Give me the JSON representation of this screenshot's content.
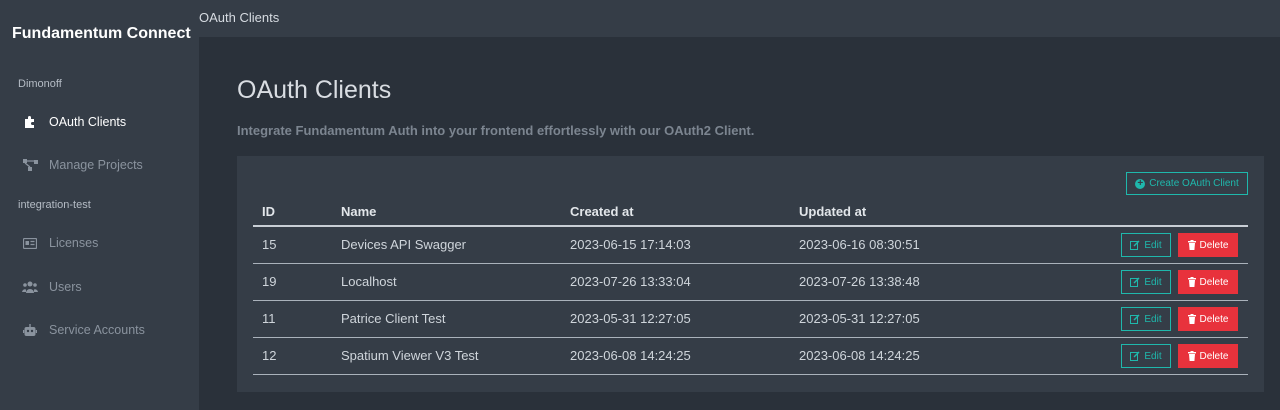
{
  "app": {
    "brand": "Fundamentum Connect"
  },
  "sidebar": {
    "groups": [
      {
        "label": "Dimonoff"
      },
      {
        "label": "integration-test"
      }
    ],
    "items": [
      {
        "label": "OAuth Clients",
        "icon": "puzzle-icon",
        "active": true
      },
      {
        "label": "Manage Projects",
        "icon": "project-diagram-icon",
        "active": false
      },
      {
        "label": "Licenses",
        "icon": "license-card-icon",
        "active": false
      },
      {
        "label": "Users",
        "icon": "users-icon",
        "active": false
      },
      {
        "label": "Service Accounts",
        "icon": "robot-icon",
        "active": false
      }
    ]
  },
  "topbar": {
    "title": "OAuth Clients"
  },
  "page": {
    "title": "OAuth Clients",
    "subtitle": "Integrate Fundamentum Auth into your frontend effortlessly with our OAuth2 Client."
  },
  "table": {
    "create_label": "Create OAuth Client",
    "columns": [
      "ID",
      "Name",
      "Created at",
      "Updated at"
    ],
    "edit_label": "Edit",
    "delete_label": "Delete",
    "rows": [
      {
        "id": "15",
        "name": "Devices API Swagger",
        "created": "2023-06-15 17:14:03",
        "updated": "2023-06-16 08:30:51"
      },
      {
        "id": "19",
        "name": "Localhost",
        "created": "2023-07-26 13:33:04",
        "updated": "2023-07-26 13:38:48"
      },
      {
        "id": "11",
        "name": "Patrice Client Test",
        "created": "2023-05-31 12:27:05",
        "updated": "2023-05-31 12:27:05"
      },
      {
        "id": "12",
        "name": "Spatium Viewer V3 Test",
        "created": "2023-06-08 14:24:25",
        "updated": "2023-06-08 14:24:25"
      }
    ]
  },
  "colors": {
    "accent": "#1fb8ac",
    "danger": "#e8323c",
    "sidebar_bg": "#353d47",
    "main_bg": "#2a313a"
  }
}
